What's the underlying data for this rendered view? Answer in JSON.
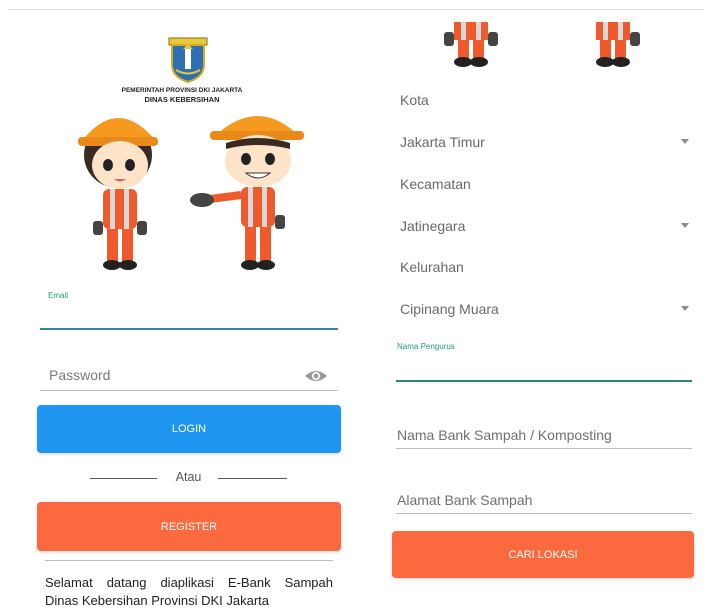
{
  "left": {
    "org_line1": "PEMERINTAH PROVINSI DKI JAKARTA",
    "org_line2": "DINAS KEBERSIHAN",
    "email_label": "Email",
    "email_value": "",
    "password_placeholder": "Password",
    "login_label": "LOGIN",
    "or_label": "Atau",
    "register_label": "REGISTER",
    "welcome_line1": "Selamat datang diaplikasi E-Bank Sampah",
    "welcome_line2": "Dinas Kebersihan Provinsi DKI Jakarta"
  },
  "right": {
    "kota_label": "Kota",
    "kota_value": "Jakarta Timur",
    "kecamatan_label": "Kecamatan",
    "kecamatan_value": "Jatinegara",
    "kelurahan_label": "Kelurahan",
    "kelurahan_value": "Cipinang Muara",
    "pengurus_label": "Nama Pengurus",
    "pengurus_value": "",
    "bank_placeholder": "Nama Bank Sampah / Komposting",
    "alamat_placeholder": "Alamat Bank Sampah",
    "cari_label": "CARI LOKASI"
  },
  "icons": {
    "emblem": "jakarta-emblem-icon",
    "mascots": "mascot-workers-icon",
    "password_toggle": "eye-icon",
    "dropdown": "chevron-down-icon"
  },
  "colors": {
    "login": "#1e95f0",
    "register": "#fb6a3f",
    "accent_teal": "#1e9a7a",
    "helmet": "#f59a1e",
    "vest": "#ef5a2c"
  }
}
